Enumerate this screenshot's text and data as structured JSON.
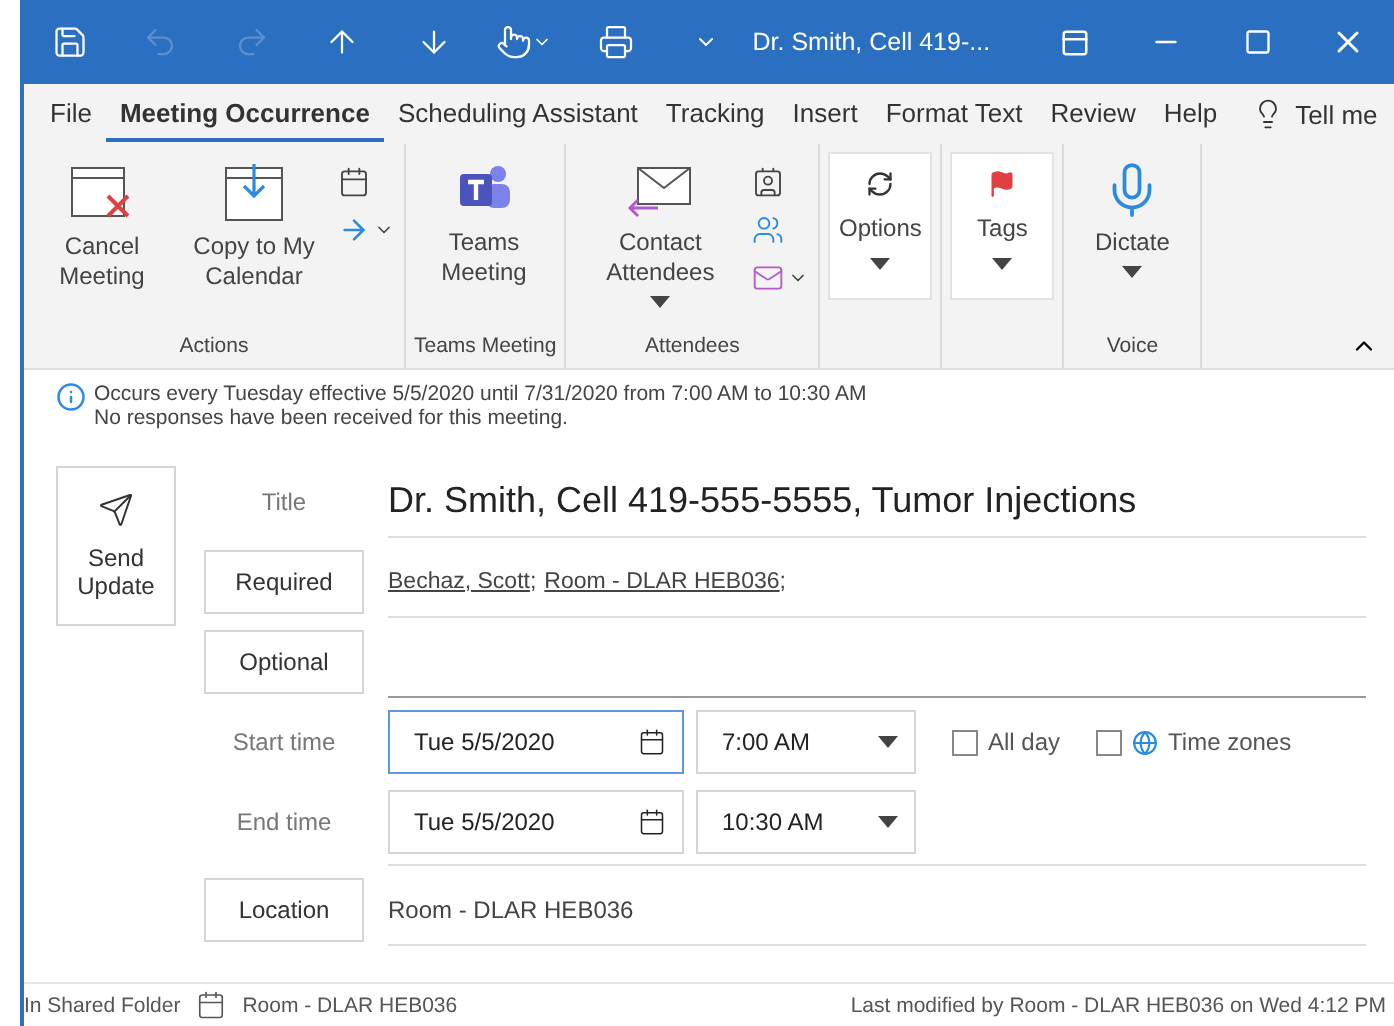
{
  "window": {
    "title": "Dr. Smith, Cell 419-..."
  },
  "tabs": [
    {
      "label": "File",
      "selected": false
    },
    {
      "label": "Meeting Occurrence",
      "selected": true
    },
    {
      "label": "Scheduling Assistant",
      "selected": false
    },
    {
      "label": "Tracking",
      "selected": false
    },
    {
      "label": "Insert",
      "selected": false
    },
    {
      "label": "Format Text",
      "selected": false
    },
    {
      "label": "Review",
      "selected": false
    },
    {
      "label": "Help",
      "selected": false
    }
  ],
  "tell_me": "Tell me",
  "ribbon": [
    {
      "label": "Actions",
      "buttons": [
        {
          "label": "Cancel Meeting",
          "kind": "large"
        },
        {
          "label": "Copy to My Calendar",
          "kind": "large"
        },
        {
          "kind": "small"
        }
      ]
    },
    {
      "label": "Teams Meeting",
      "buttons": [
        {
          "label": "Teams Meeting",
          "kind": "large"
        }
      ]
    },
    {
      "label": "Attendees",
      "buttons": [
        {
          "label": "Contact Attendees",
          "kind": "large",
          "dropdown": true
        },
        {
          "kind": "small"
        }
      ]
    },
    {
      "buttons": [
        {
          "label": "Options",
          "kind": "boxed",
          "dropdown": true
        }
      ]
    },
    {
      "buttons": [
        {
          "label": "Tags",
          "kind": "boxed",
          "dropdown": true
        }
      ]
    },
    {
      "label": "Voice",
      "buttons": [
        {
          "label": "Dictate",
          "kind": "large",
          "dropdown": true
        }
      ]
    }
  ],
  "info": [
    "Occurs every Tuesday effective 5/5/2020 until 7/31/2020 from 7:00 AM to 10:30 AM",
    "No responses have been received for this meeting."
  ],
  "send_button": "Send Update",
  "form": {
    "title_label": "Title",
    "title": "Dr. Smith, Cell 419-555-5555, Tumor Injections",
    "required_button": "Required",
    "required": [
      "Bechaz, Scott",
      "Room - DLAR HEB036"
    ],
    "separator": ";",
    "optional_button": "Optional",
    "start_label": "Start time",
    "start_date": "Tue 5/5/2020",
    "start_time": "7:00 AM",
    "all_day": {
      "label": "All day",
      "checked": false
    },
    "time_zones": {
      "label": "Time zones",
      "checked": false
    },
    "end_label": "End time",
    "end_date": "Tue 5/5/2020",
    "end_time": "10:30 AM",
    "location_button": "Location",
    "location": "Room - DLAR HEB036"
  },
  "status_bar": {
    "folder_label": "In Shared Folder",
    "folder": "Room - DLAR HEB036",
    "modified": "Last modified by Room - DLAR HEB036 on Wed 4:12 PM"
  }
}
